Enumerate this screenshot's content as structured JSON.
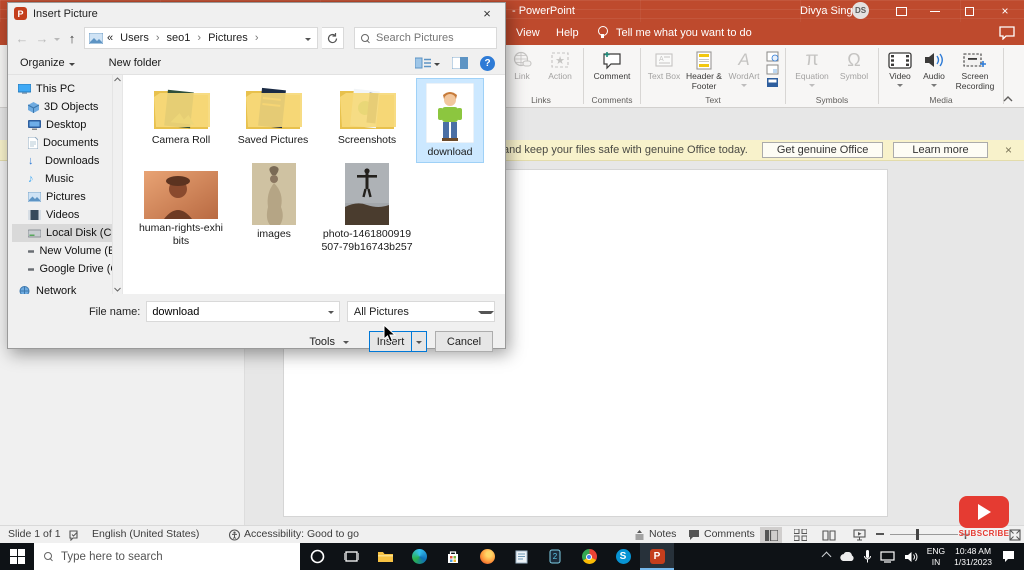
{
  "window": {
    "title": "- PowerPoint",
    "user": "Divya Singh",
    "avatar_initials": "DS"
  },
  "menu": {
    "view": "View",
    "help": "Help",
    "tellme": "Tell me what you want to do"
  },
  "ribbon": {
    "groups": [
      {
        "label": "Links"
      },
      {
        "label": "Comments"
      },
      {
        "label": "Text"
      },
      {
        "label": "Symbols"
      },
      {
        "label": "Media"
      }
    ],
    "buttons": {
      "link": "Link",
      "action": "Action",
      "comment": "Comment",
      "text_box": "Text Box",
      "header_footer": "Header & Footer",
      "wordart": "WordArt",
      "equation": "Equation",
      "symbol": "Symbol",
      "video": "Video",
      "audio": "Audio",
      "screen_recording": "Screen Recording"
    },
    "glyphs": {
      "pi": "π",
      "omega": "Ω",
      "wordart_a": "A"
    }
  },
  "notice": {
    "message": "and keep your files safe with genuine Office today.",
    "get_genuine": "Get genuine Office",
    "learn_more": "Learn more",
    "close": "×"
  },
  "dialog": {
    "title": "Insert Picture",
    "breadcrumb_home": "«",
    "breadcrumb": [
      "Users",
      "seo1",
      "Pictures"
    ],
    "breadcrumb_sep": "›",
    "search_placeholder": "Search Pictures",
    "toolbar": {
      "organize": "Organize",
      "new_folder": "New folder"
    },
    "sidebar": [
      {
        "label": "This PC"
      },
      {
        "label": "3D Objects"
      },
      {
        "label": "Desktop"
      },
      {
        "label": "Documents"
      },
      {
        "label": "Downloads"
      },
      {
        "label": "Music"
      },
      {
        "label": "Pictures"
      },
      {
        "label": "Videos"
      },
      {
        "label": "Local Disk (C:)"
      },
      {
        "label": "New Volume (E:)"
      },
      {
        "label": "Google Drive (G:"
      },
      {
        "label": "Network"
      }
    ],
    "folders": [
      {
        "name": "Camera Roll"
      },
      {
        "name": "Saved Pictures"
      },
      {
        "name": "Screenshots"
      }
    ],
    "images": [
      {
        "name": "download",
        "selected": true
      },
      {
        "name": "human-rights-exhibits"
      },
      {
        "name": "images"
      },
      {
        "name": "photo-1461800919507-79b16743b257"
      }
    ],
    "file_name_label": "File name:",
    "file_name_value": "download",
    "file_type": "All Pictures",
    "tools": "Tools",
    "insert": "Insert",
    "cancel": "Cancel",
    "close": "×"
  },
  "status": {
    "slide": "Slide 1 of 1",
    "language": "English (United States)",
    "accessibility": "Accessibility: Good to go",
    "notes": "Notes",
    "comments": "Comments"
  },
  "taskbar": {
    "search_placeholder": "Type here to search",
    "lang1": "ENG",
    "lang2": "IN",
    "time": "10:48 AM",
    "date": "1/31/2023"
  },
  "overlay": {
    "subscribe": "SUBSCRIBE"
  }
}
